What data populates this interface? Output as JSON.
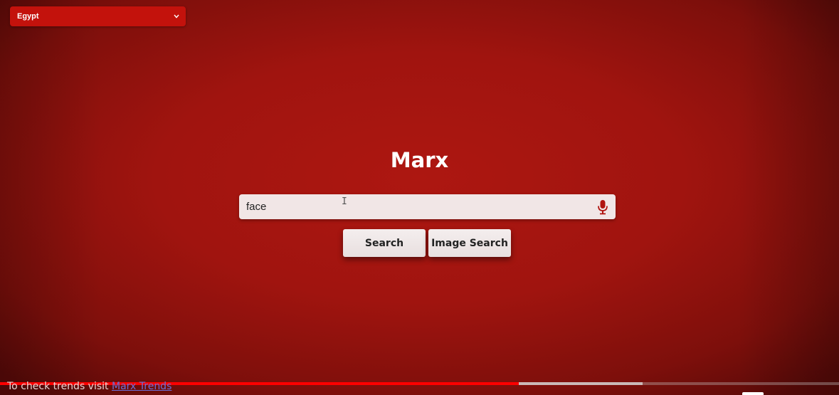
{
  "country_select": {
    "selected": "Egypt",
    "icon": "chevron-down-icon"
  },
  "brand": {
    "title": "Marx"
  },
  "search": {
    "value": "face",
    "mic_icon": "microphone-icon",
    "mic_color": "#b01410"
  },
  "buttons": {
    "search_label": "Search",
    "image_search_label": "Image Search"
  },
  "footer": {
    "text": "To check trends visit ",
    "link_label": "Marx  Trends"
  },
  "video_progress": {
    "played_fraction": 0.618,
    "buffered_fraction": 0.766,
    "played_color": "#ff0000"
  },
  "colors": {
    "background": "#a0140f",
    "accent": "#c3120c",
    "button_bg": "#f1e6e6"
  }
}
